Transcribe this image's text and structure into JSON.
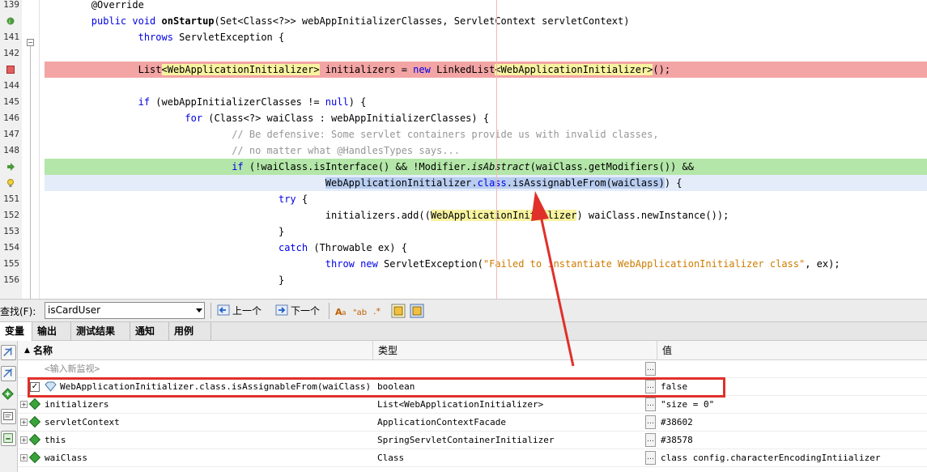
{
  "editor": {
    "lines": [
      {
        "num": "139",
        "parts": [
          [
            "",
            "        @Override"
          ]
        ]
      },
      {
        "num": "",
        "parts": [
          [
            "kw",
            "        public "
          ],
          [
            "kw",
            "void "
          ],
          [
            "b",
            "onStartup"
          ],
          [
            "",
            "(Set<Class<?>> webAppInitializerClasses, ServletContext servletContext)"
          ]
        ]
      },
      {
        "num": "141",
        "parts": [
          [
            "",
            "                "
          ],
          [
            "kw",
            "throws "
          ],
          [
            "",
            "ServletException {"
          ]
        ]
      },
      {
        "num": "142",
        "parts": [
          [
            "",
            ""
          ]
        ]
      },
      {
        "num": "",
        "parts": [
          [
            "",
            "                List"
          ],
          [
            "yh",
            "<WebApplicationInitializer>"
          ],
          [
            "",
            " initializers = "
          ],
          [
            "kw",
            "new "
          ],
          [
            "",
            "LinkedList"
          ],
          [
            "yh",
            "<WebApplicationInitializer>"
          ],
          [
            "",
            "();"
          ]
        ]
      },
      {
        "num": "144",
        "parts": [
          [
            "",
            ""
          ]
        ]
      },
      {
        "num": "145",
        "parts": [
          [
            "",
            "                "
          ],
          [
            "kw",
            "if "
          ],
          [
            "",
            "(webAppInitializerClasses != "
          ],
          [
            "kw",
            "null"
          ],
          [
            "",
            ") {"
          ]
        ]
      },
      {
        "num": "146",
        "parts": [
          [
            "",
            "                        "
          ],
          [
            "kw",
            "for "
          ],
          [
            "",
            "(Class<?> waiClass : webAppInitializerClasses) {"
          ]
        ]
      },
      {
        "num": "147",
        "parts": [
          [
            "cm",
            "                                // Be defensive: Some servlet containers provide us with invalid classes,"
          ]
        ]
      },
      {
        "num": "148",
        "parts": [
          [
            "cm",
            "                                // no matter what @HandlesTypes says..."
          ]
        ]
      },
      {
        "num": "",
        "parts": [
          [
            "",
            "                                "
          ],
          [
            "kw",
            "if "
          ],
          [
            "",
            "(!waiClass.isInterface() && !Modifier."
          ],
          [
            "it",
            "isAbstract"
          ],
          [
            "",
            "(waiClass.getModifiers()) &&"
          ]
        ]
      },
      {
        "num": "",
        "parts": [
          [
            "",
            "                                                "
          ],
          [
            "sel",
            "WebApplicationInitializer."
          ],
          [
            "selkw",
            "class"
          ],
          [
            "sel",
            ".isAssignableFrom(waiClass)"
          ],
          [
            "",
            ") {"
          ]
        ]
      },
      {
        "num": "151",
        "parts": [
          [
            "",
            "                                        "
          ],
          [
            "kw",
            "try "
          ],
          [
            "",
            "{"
          ]
        ]
      },
      {
        "num": "152",
        "parts": [
          [
            "",
            "                                                initializers.add(("
          ],
          [
            "yh",
            "WebApplicationInitializer"
          ],
          [
            "",
            ") waiClass.newInstance());"
          ]
        ]
      },
      {
        "num": "153",
        "parts": [
          [
            "",
            "                                        }"
          ]
        ]
      },
      {
        "num": "154",
        "parts": [
          [
            "",
            "                                        "
          ],
          [
            "kw",
            "catch "
          ],
          [
            "",
            "(Throwable ex) {"
          ]
        ]
      },
      {
        "num": "155",
        "parts": [
          [
            "",
            "                                                "
          ],
          [
            "kw",
            "throw "
          ],
          [
            "kw",
            "new "
          ],
          [
            "",
            "ServletException("
          ],
          [
            "str",
            "\"Failed to instantiate WebApplicationInitializer class\""
          ],
          [
            "",
            ", ex);"
          ]
        ]
      },
      {
        "num": "156",
        "parts": [
          [
            "",
            "                                        }"
          ]
        ]
      }
    ]
  },
  "findbar": {
    "label": "查找(F):",
    "value": "isCardUser",
    "prev": "上一个",
    "next": "下一个"
  },
  "tabs": [
    "变量",
    "输出",
    "测试结果",
    "通知",
    "用例"
  ],
  "variables": {
    "headers": {
      "name": "名称",
      "type": "类型",
      "value": "值"
    },
    "new_watch": "<输入新监视>",
    "rows": [
      {
        "name": "WebApplicationInitializer.class.isAssignableFrom(waiClass)",
        "type": "boolean",
        "value": "false",
        "kind": "watch"
      },
      {
        "name": "initializers",
        "type": "List<WebApplicationInitializer>",
        "value": "\"size = 0\"",
        "kind": "var"
      },
      {
        "name": "servletContext",
        "type": "ApplicationContextFacade",
        "value": "#38602",
        "kind": "var"
      },
      {
        "name": "this",
        "type": "SpringServletContainerInitializer",
        "value": "#38578",
        "kind": "var"
      },
      {
        "name": "waiClass",
        "type": "Class",
        "value": "class        config.characterEncodingIntiializer",
        "kind": "var"
      }
    ]
  },
  "colors": {
    "accent_red": "#e0302a",
    "breakpoint_line": "#f3a4a4",
    "current_line": "#b3e6a8",
    "keyword": "#0000e6"
  }
}
